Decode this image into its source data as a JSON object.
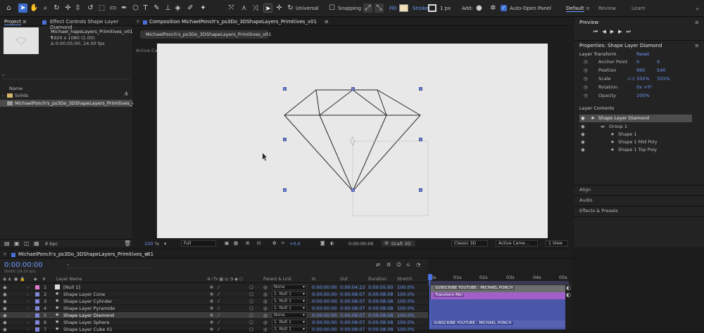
{
  "toolbar": {
    "universal_label": "Universal",
    "snapping_label": "Snapping",
    "fill_label": "Fill:",
    "stroke_label": "Stroke:",
    "stroke_width": "1 px",
    "add_label": "Add:",
    "auto_open_label": "Auto-Open Panel",
    "workspaces": [
      "Default",
      "Review",
      "Learn"
    ]
  },
  "project": {
    "tab": "Project",
    "effect_controls_tab": "Effect Controls Shape Layer Diamond",
    "comp_name": "Michael_hapeLayers_Primitives_v01 ▾",
    "comp_res": "1920 x 1080 (1.00)",
    "comp_dur": "Δ 0:00:05:00, 24.00 fps",
    "search_placeholder": "⌕",
    "name_header": "Name",
    "items": [
      "Solids",
      "MichaelPonch's_ps3Do_3DShapeLayers_Primitives_v0"
    ],
    "bpc": "8 bpc"
  },
  "composition": {
    "tab": "Composition MichaelPonch's_ps3Do_3DShapeLayers_Primitives_v01",
    "subtab": "MichaelPonch's_ps3Do_3DShapeLayers_Primitives_v01",
    "camera_label": "Active Camera (Default)",
    "zoom": "100",
    "zoom_unit": "%",
    "quality": "Full",
    "exposure": "+0.0",
    "timecode": "0:00:00:00",
    "renderer": "Draft 3D",
    "view_3d": "Classic 3D",
    "camera": "Active Came...",
    "views": "1 View"
  },
  "preview": {
    "tab": "Preview"
  },
  "properties": {
    "tab": "Properties: Shape Layer Diamond",
    "transform_label": "Layer Transform",
    "reset_label": "Reset",
    "rows": [
      {
        "name": "Anchor Point",
        "v1": "0",
        "v2": "0"
      },
      {
        "name": "Position",
        "v1": "960",
        "v2": "540"
      },
      {
        "name": "Scale",
        "v1": "331%",
        "v2": "331%"
      },
      {
        "name": "Rotation",
        "v1": "0x +0°",
        "v2": ""
      },
      {
        "name": "Opacity",
        "v1": "100%",
        "v2": ""
      }
    ],
    "contents_label": "Layer Contents",
    "contents": [
      {
        "label": "Shape Layer Diamond",
        "indent": 0
      },
      {
        "label": "Group 1",
        "indent": 1
      },
      {
        "label": "Shape 1",
        "indent": 2
      },
      {
        "label": "Shape 1 Mid Poly",
        "indent": 2
      },
      {
        "label": "Shape 1 Top Poly",
        "indent": 2
      }
    ],
    "panels": [
      "Align",
      "Audio",
      "Effects & Presets"
    ]
  },
  "timeline": {
    "tab": "MichaelPonch's_ps3Do_3DShapeLayers_Primitives_v01",
    "timecode": "0:00:00:00",
    "fps_note": "00000 (24.00 fps)",
    "headers": {
      "name": "Layer Name",
      "parent": "Parent & Link",
      "in": "In",
      "out": "Out",
      "duration": "Duration",
      "stretch": "Stretch"
    },
    "ruler": [
      "0s",
      "01s",
      "02s",
      "03s",
      "04s",
      "05s"
    ],
    "layers": [
      {
        "num": "1",
        "name": "[Null 1]",
        "color": "#e07ccc",
        "parent": "None",
        "in": "0:00:00:00",
        "out": "0:00:04:23",
        "dur": "0:00:05:00",
        "stretch": "100.0%"
      },
      {
        "num": "2",
        "name": "Shape Layer Cone",
        "color": "#7f86d8",
        "parent": "1. Null 1",
        "in": "0:00:00:00",
        "out": "0:00:08:07",
        "dur": "0:00:08:08",
        "stretch": "100.0%"
      },
      {
        "num": "3",
        "name": "Shape Layer Cylinder",
        "color": "#7f86d8",
        "parent": "1. Null 1",
        "in": "0:00:00:00",
        "out": "0:00:08:07",
        "dur": "0:00:08:08",
        "stretch": "100.0%"
      },
      {
        "num": "4",
        "name": "Shape Layer Pyramide",
        "color": "#7f86d8",
        "parent": "1. Null 1",
        "in": "0:00:00:00",
        "out": "0:00:08:07",
        "dur": "0:00:08:08",
        "stretch": "100.0%"
      },
      {
        "num": "5",
        "name": "Shape Layer Diamond",
        "color": "#7f86d8",
        "parent": "None",
        "in": "0:00:00:00",
        "out": "0:00:08:07",
        "dur": "0:00:08:08",
        "stretch": "100.0%"
      },
      {
        "num": "6",
        "name": "Shape Layer Sphere",
        "color": "#7f86d8",
        "parent": "1. Null 1",
        "in": "0:00:00:00",
        "out": "0:00:08:07",
        "dur": "0:00:08:08",
        "stretch": "100.0%"
      },
      {
        "num": "7",
        "name": "Shape Layer Cube 01",
        "color": "#7f86d8",
        "parent": "1. Null 1",
        "in": "0:00:00:00",
        "out": "0:00:08:07",
        "dur": "0:00:08:08",
        "stretch": "100.0%"
      }
    ],
    "bar_labels": [
      "SUBSCRIBE YOUTUBE : MICHAEL PONCH",
      "Transform Me!",
      "SUBSCRIBE YOUTUBE : MICHAEL PONCH"
    ]
  }
}
